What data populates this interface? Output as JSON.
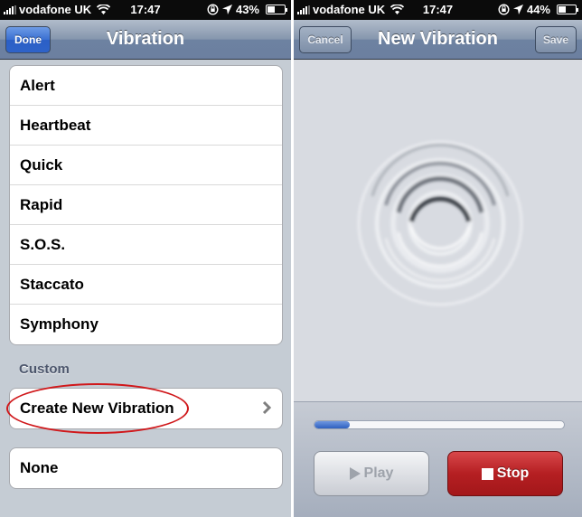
{
  "left": {
    "status": {
      "carrier": "vodafone UK",
      "time": "17:47",
      "battery": "43%",
      "battery_level": 0.43
    },
    "nav": {
      "title": "Vibration",
      "done": "Done"
    },
    "standard_items": [
      "Alert",
      "Heartbeat",
      "Quick",
      "Rapid",
      "S.O.S.",
      "Staccato",
      "Symphony"
    ],
    "custom_header": "Custom",
    "create_new": "Create New Vibration",
    "none": "None"
  },
  "right": {
    "status": {
      "carrier": "vodafone UK",
      "time": "17:47",
      "battery": "44%",
      "battery_level": 0.44
    },
    "nav": {
      "title": "New Vibration",
      "cancel": "Cancel",
      "save": "Save"
    },
    "progress": 0.14,
    "play": "Play",
    "stop": "Stop"
  },
  "colors": {
    "highlight_oval": "#d0181b",
    "stop_red": "#b51f22",
    "nav_blue": "#6d82a1"
  },
  "icons": [
    "signal-icon",
    "wifi-icon",
    "lock-rotation-icon",
    "location-arrow-icon",
    "battery-icon",
    "chevron-right-icon",
    "play-icon",
    "stop-icon",
    "ripple-icon"
  ]
}
